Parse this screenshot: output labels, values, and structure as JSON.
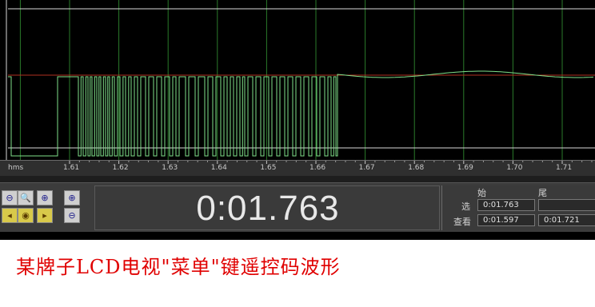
{
  "waveform": {
    "baseline_color": "#b03020",
    "signal_color": "#7fe08a",
    "grid_color": "#2a7a2a"
  },
  "ruler": {
    "unit": "hms",
    "ticks": [
      "1.61",
      "1.62",
      "1.63",
      "1.64",
      "1.65",
      "1.66",
      "1.67",
      "1.68",
      "1.69",
      "1.70",
      "1.71"
    ]
  },
  "zoom_buttons": [
    {
      "name": "zoom-out-icon"
    },
    {
      "name": "zoom-selection-icon"
    },
    {
      "name": "zoom-in-icon"
    },
    {
      "name": "zoom-in-left-icon"
    },
    {
      "name": "zoom-in-center-icon"
    },
    {
      "name": "zoom-out-full-icon"
    }
  ],
  "time_display": {
    "value": "0:01.763"
  },
  "selection_panel": {
    "col_start": "始",
    "col_end": "尾",
    "row_select": "选",
    "row_view": "查看",
    "select_start": "0:01.763",
    "select_end": "",
    "view_start": "0:01.597",
    "view_end": "0:01.721"
  },
  "caption": "某牌子LCD电视\"菜单\"键遥控码波形"
}
